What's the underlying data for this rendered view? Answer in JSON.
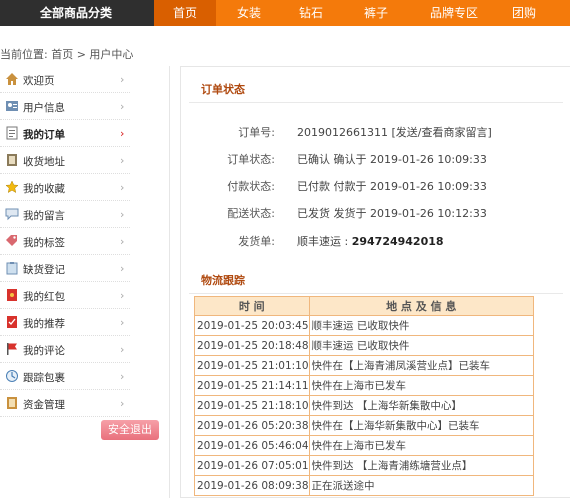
{
  "topnav": {
    "category_title": "全部商品分类",
    "items": [
      {
        "label": "首页",
        "active": true
      },
      {
        "label": "女装",
        "active": false
      },
      {
        "label": "钻石",
        "active": false
      },
      {
        "label": "裤子",
        "active": false
      },
      {
        "label": "品牌专区",
        "active": false
      },
      {
        "label": "团购",
        "active": false
      }
    ]
  },
  "breadcrumb": "当前位置: 首页 > 用户中心",
  "sidebar": {
    "items": [
      {
        "label": "欢迎页",
        "icon": "home-icon",
        "active": false
      },
      {
        "label": "用户信息",
        "icon": "user-card-icon",
        "active": false
      },
      {
        "label": "我的订单",
        "icon": "document-icon",
        "active": true
      },
      {
        "label": "收货地址",
        "icon": "address-book-icon",
        "active": false
      },
      {
        "label": "我的收藏",
        "icon": "star-icon",
        "active": false
      },
      {
        "label": "我的留言",
        "icon": "speech-bubble-icon",
        "active": false
      },
      {
        "label": "我的标签",
        "icon": "tag-icon",
        "active": false
      },
      {
        "label": "缺货登记",
        "icon": "clipboard-icon",
        "active": false
      },
      {
        "label": "我的红包",
        "icon": "red-envelope-icon",
        "active": false
      },
      {
        "label": "我的推荐",
        "icon": "recommend-icon",
        "active": false
      },
      {
        "label": "我的评论",
        "icon": "flag-icon",
        "active": false
      },
      {
        "label": "跟踪包裹",
        "icon": "package-icon",
        "active": false
      },
      {
        "label": "资金管理",
        "icon": "wallet-icon",
        "active": false
      }
    ],
    "logout_label": "安全退出"
  },
  "order_status": {
    "title": "订单状态",
    "rows": [
      {
        "label": "订单号:",
        "value": "2019012661311 [发送/查看商家留言]"
      },
      {
        "label": "订单状态:",
        "value": "已确认   确认于 2019-01-26 10:09:33"
      },
      {
        "label": "付款状态:",
        "value": "已付款   付款于 2019-01-26 10:09:33"
      },
      {
        "label": "配送状态:",
        "value": "已发货   发货于 2019-01-26 10:12:33"
      }
    ],
    "invoice_label": "发货单:",
    "invoice_carrier": "顺丰速运 : ",
    "invoice_number": "294724942018"
  },
  "tracking": {
    "title": "物流跟踪",
    "col_time": "时 间",
    "col_info": "地 点 及 信 息",
    "rows": [
      {
        "time": "2019-01-25 20:03:45",
        "info": "顺丰速运 已收取快件"
      },
      {
        "time": "2019-01-25 20:18:48",
        "info": "顺丰速运 已收取快件"
      },
      {
        "time": "2019-01-25 21:01:10",
        "info": "快件在【上海青浦凤溪营业点】已装车"
      },
      {
        "time": "2019-01-25 21:14:11",
        "info": "快件在上海市已发车"
      },
      {
        "time": "2019-01-25 21:18:10",
        "info": "快件到达 【上海华新集散中心】"
      },
      {
        "time": "2019-01-26 05:20:38",
        "info": "快件在【上海华新集散中心】已装车"
      },
      {
        "time": "2019-01-26 05:46:04",
        "info": "快件在上海市已发车"
      },
      {
        "time": "2019-01-26 07:05:01",
        "info": "快件到达 【上海青浦练塘营业点】"
      },
      {
        "time": "2019-01-26 08:09:38",
        "info": "正在派送途中"
      }
    ]
  },
  "colors": {
    "nav_orange": "#f47a0b",
    "category_dark": "#2f2f2f",
    "section_title": "#b04a10",
    "table_border": "#f0b77d",
    "table_header_bg": "#fde7c8"
  }
}
